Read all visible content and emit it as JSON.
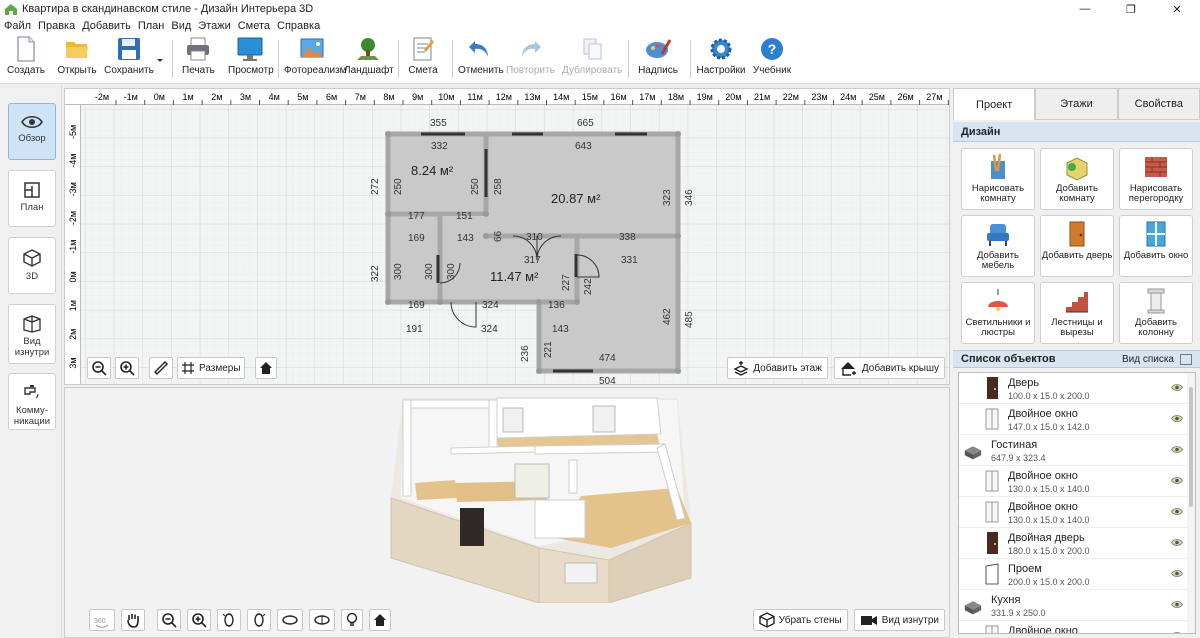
{
  "window": {
    "title": "Квартира в скандинавском стиле - Дизайн Интерьера 3D",
    "minimize": "—",
    "maximize": "❐",
    "close": "✕"
  },
  "menu": [
    "Файл",
    "Правка",
    "Добавить",
    "План",
    "Вид",
    "Этажи",
    "Смета",
    "Справка"
  ],
  "toolbar": {
    "create": "Создать",
    "open": "Открыть",
    "save": "Сохранить",
    "print": "Печать",
    "preview": "Просмотр",
    "photorealism": "Фотореализм",
    "landscape": "Ландшафт",
    "estimate": "Смета",
    "undo": "Отменить",
    "redo": "Повторить",
    "duplicate": "Дублировать",
    "caption": "Надпись",
    "settings": "Настройки",
    "tutorial": "Учебник"
  },
  "leftnav": {
    "overview": "Обзор",
    "plan": "План",
    "view3d": "3D",
    "inside": "Вид изнутри",
    "utilities": "Комму-никации"
  },
  "ruler": {
    "top": [
      "-2м",
      "-1м",
      "0м",
      "1м",
      "2м",
      "3м",
      "4м",
      "5м",
      "6м",
      "7м",
      "8м",
      "9м",
      "10м",
      "11м",
      "12м",
      "13м",
      "14м",
      "15м",
      "16м",
      "17м",
      "18м",
      "19м",
      "20м",
      "21м",
      "22м",
      "23м",
      "24м",
      "25м",
      "26м",
      "27м"
    ],
    "left": [
      "-5м",
      "-4м",
      "-3м",
      "-2м",
      "-1м",
      "0м",
      "1м",
      "2м",
      "3м"
    ]
  },
  "plan": {
    "rooms": [
      {
        "area": "8.24 м²"
      },
      {
        "area": "20.87 м²"
      },
      {
        "area": "11.47 м²"
      }
    ],
    "dims": [
      "355",
      "665",
      "332",
      "643",
      "272",
      "250",
      "250",
      "258",
      "323",
      "346",
      "177",
      "151",
      "169",
      "143",
      "66",
      "310",
      "338",
      "317",
      "331",
      "322",
      "300",
      "300",
      "300",
      "11.47",
      "227",
      "242",
      "169",
      "324",
      "136",
      "485",
      "462",
      "191",
      "324",
      "143",
      "236",
      "221",
      "474",
      "504"
    ],
    "tools": {
      "dimensions": "Размеры",
      "add_floor": "Добавить этаж",
      "add_roof": "Добавить крышу"
    }
  },
  "view3d": {
    "remove_walls": "Убрать стены",
    "inside_view": "Вид изнутри"
  },
  "rpanel": {
    "tabs": [
      "Проект",
      "Этажи",
      "Свойства"
    ],
    "design_section": "Дизайн",
    "tools": [
      "Нарисовать комнату",
      "Добавить комнату",
      "Нарисовать перегородку",
      "Добавить мебель",
      "Добавить дверь",
      "Добавить окно",
      "Светильники и люстры",
      "Лестницы и вырезы",
      "Добавить колонну"
    ],
    "list_title": "Список объектов",
    "list_view": "Вид списка",
    "objects": [
      {
        "name": "Дверь",
        "dims": "100.0 x 15.0 x 200.0",
        "type": "door"
      },
      {
        "name": "Двойное окно",
        "dims": "147.0 x 15.0 x 142.0",
        "type": "window"
      },
      {
        "name": "Гостиная",
        "dims": "647.9 x 323.4",
        "type": "room"
      },
      {
        "name": "Двойное окно",
        "dims": "130.0 x 15.0 x 140.0",
        "type": "window"
      },
      {
        "name": "Двойное окно",
        "dims": "130.0 x 15.0 x 140.0",
        "type": "window"
      },
      {
        "name": "Двойная дверь",
        "dims": "180.0 x 15.0 x 200.0",
        "type": "door"
      },
      {
        "name": "Проем",
        "dims": "200.0 x 15.0 x 200.0",
        "type": "opening"
      },
      {
        "name": "Кухня",
        "dims": "331.9 x 250.0",
        "type": "room"
      },
      {
        "name": "Двойное окно",
        "dims": "",
        "type": "window"
      }
    ]
  },
  "colors": {
    "accent": "#3f7fc6",
    "active_nav": "#cfe3f7",
    "room_fill": "#c7c7c7",
    "wall": "#9a9a9a"
  }
}
